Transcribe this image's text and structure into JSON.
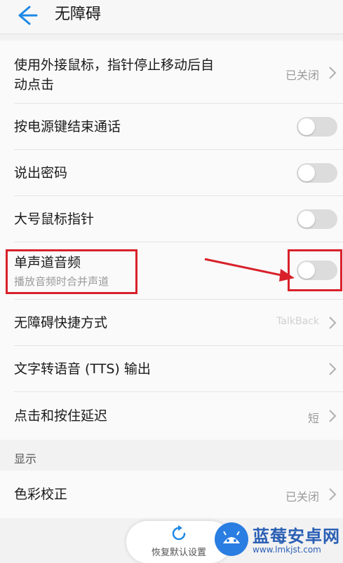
{
  "header": {
    "title": "无障碍"
  },
  "rows": [
    {
      "label_line1": "使用外接鼠标，指针停止移动后自",
      "label_line2": "动点击",
      "value": "已关闭"
    },
    {
      "label": "按电源键结束通话",
      "toggle_on": false
    },
    {
      "label": "说出密码",
      "toggle_on": false
    },
    {
      "label": "大号鼠标指针",
      "toggle_on": false
    },
    {
      "label": "单声道音频",
      "subtitle": "播放音频时合并声道",
      "toggle_on": false
    },
    {
      "label": "无障碍快捷方式",
      "value": "TalkBack"
    },
    {
      "label": "文字转语音 (TTS) 输出"
    },
    {
      "label": "点击和按住延迟",
      "value": "短"
    }
  ],
  "section": {
    "title": "显示"
  },
  "display_rows": [
    {
      "label": "色彩校正",
      "value": "已关闭"
    }
  ],
  "footer": {
    "restore_label": "恢复默认设置"
  },
  "watermark": {
    "name": "蓝莓安卓网",
    "url": "www.lmkjst.com"
  },
  "colors": {
    "accent": "#1e88e5",
    "highlight": "#d8212a",
    "toggle_off": "#dcdcdc"
  },
  "icons": {
    "back": "arrow-left-icon",
    "chevron": "chevron-right-icon",
    "restore": "refresh-icon"
  }
}
